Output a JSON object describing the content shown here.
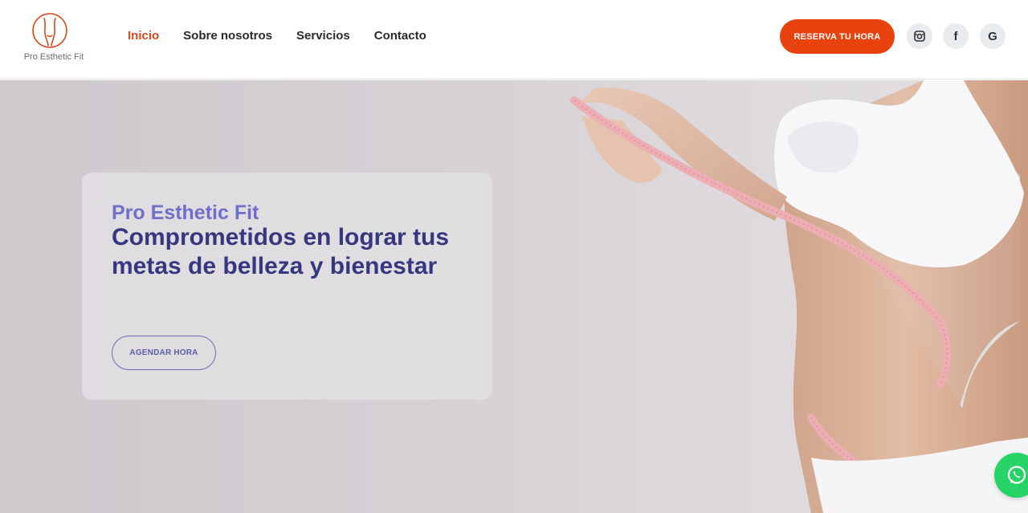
{
  "brand": {
    "name": "Pro Esthetic Fit",
    "accent": "#e8430f"
  },
  "nav": {
    "items": [
      {
        "label": "Inicio",
        "active": true
      },
      {
        "label": "Sobre nosotros",
        "active": false
      },
      {
        "label": "Servicios",
        "active": false
      },
      {
        "label": "Contacto",
        "active": false
      }
    ]
  },
  "header": {
    "cta_label": "RESERVA TU HORA",
    "social": [
      {
        "icon": "instagram-icon"
      },
      {
        "icon": "facebook-icon",
        "glyph": "f"
      },
      {
        "icon": "google-icon",
        "glyph": "G"
      }
    ]
  },
  "hero": {
    "eyebrow": "Pro Esthetic Fit",
    "title": "Comprometidos en lograr tus metas de belleza y bienestar",
    "button_label": "AGENDAR HORA",
    "title_color": "#36387f",
    "eyebrow_color": "#6f6fc9"
  },
  "floating": {
    "icon": "whatsapp-icon",
    "color": "#25d366"
  }
}
